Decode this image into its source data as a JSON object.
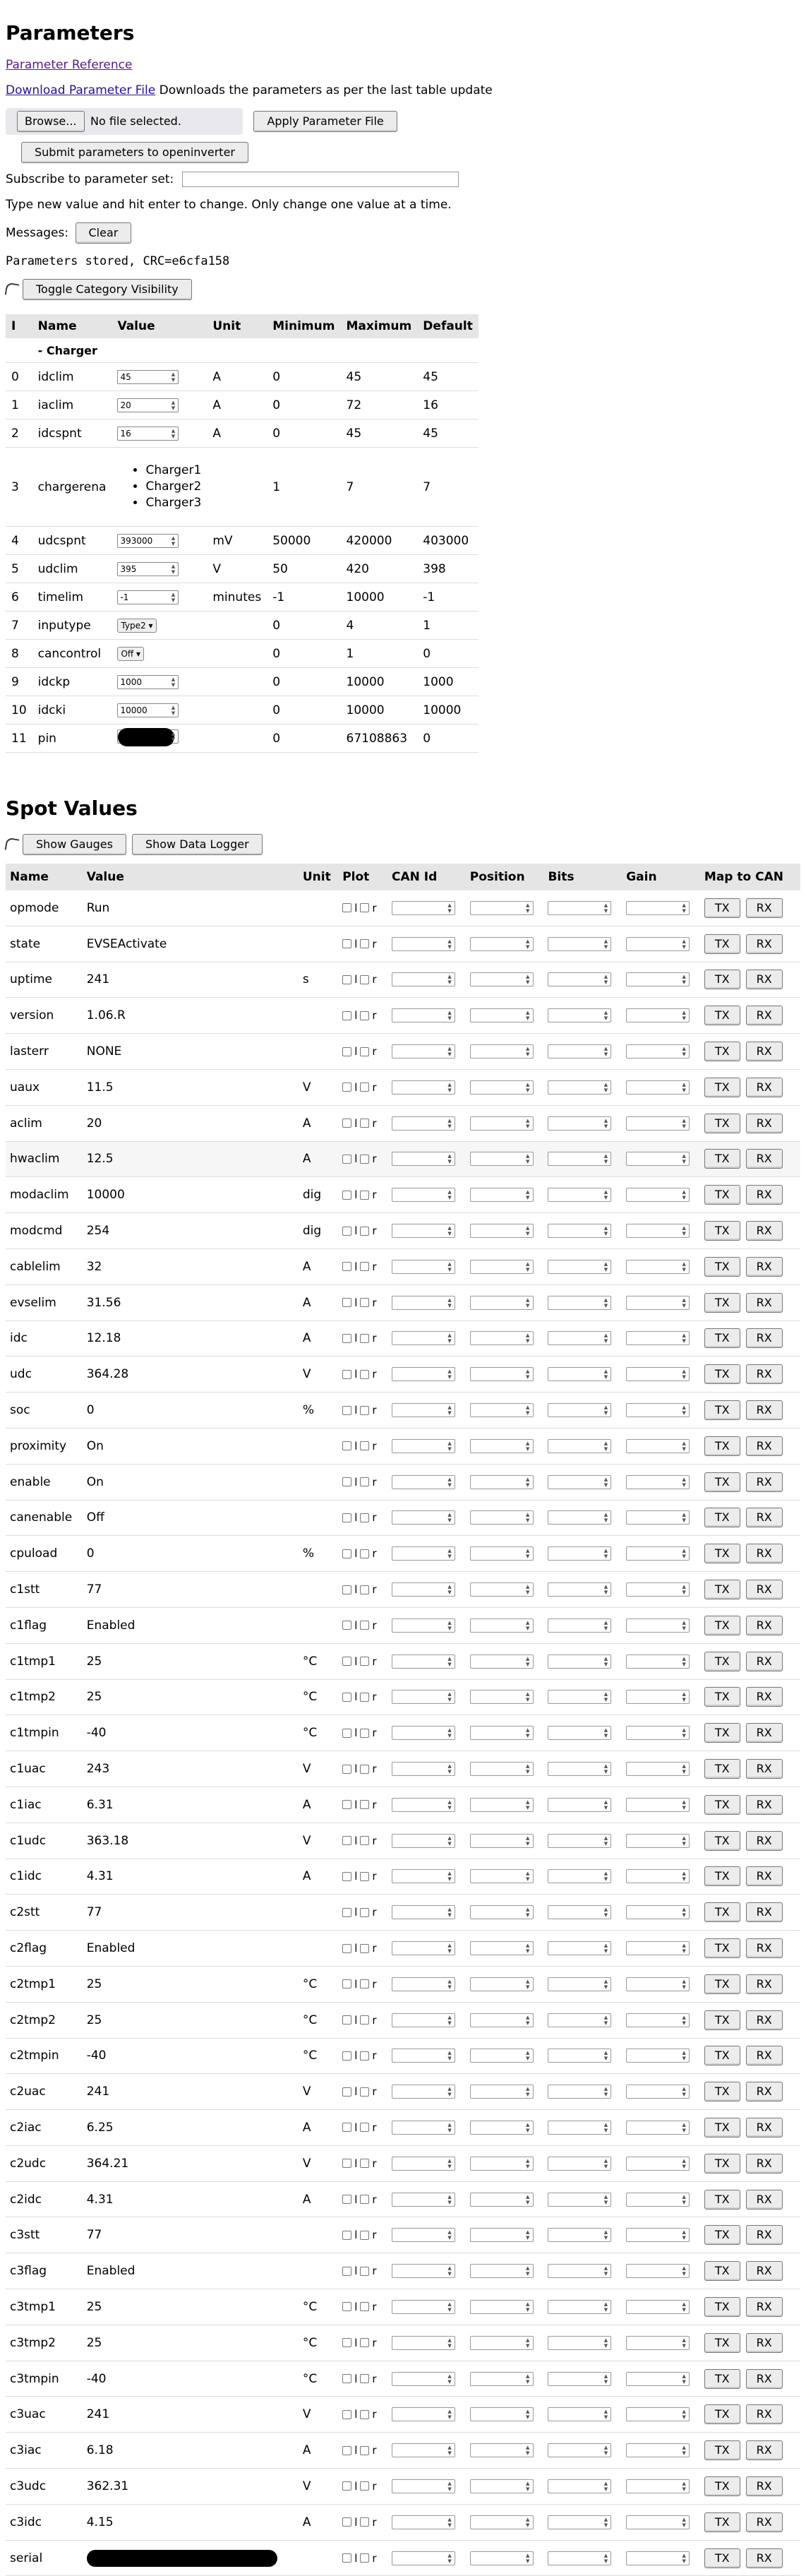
{
  "params_title": "Parameters",
  "links": {
    "reference": "Parameter Reference",
    "download": "Download Parameter File",
    "download_note": "Downloads the parameters as per the last table update"
  },
  "file": {
    "browse": "Browse...",
    "no_file": "No file selected.",
    "apply": "Apply Parameter File"
  },
  "submit_label": "Submit parameters to openinverter",
  "subscribe_label": "Subscribe to parameter set:",
  "instructions": "Type new value and hit enter to change. Only change one value at a time.",
  "messages_label": "Messages:",
  "clear_label": "Clear",
  "stored_msg": "Parameters stored, CRC=e6cfa158",
  "toggle_category": "Toggle Category Visibility",
  "param_headers": [
    "I",
    "Name",
    "Value",
    "Unit",
    "Minimum",
    "Maximum",
    "Default"
  ],
  "category": "- Charger",
  "params": [
    {
      "i": "0",
      "name": "idclim",
      "value": "45",
      "unit": "A",
      "min": "0",
      "max": "45",
      "def": "45"
    },
    {
      "i": "1",
      "name": "iaclim",
      "value": "20",
      "unit": "A",
      "min": "0",
      "max": "72",
      "def": "16"
    },
    {
      "i": "2",
      "name": "idcspnt",
      "value": "16",
      "unit": "A",
      "min": "0",
      "max": "45",
      "def": "45"
    },
    {
      "i": "3",
      "name": "chargerena",
      "options": [
        "Charger1",
        "Charger2",
        "Charger3"
      ],
      "unit": "",
      "min": "1",
      "max": "7",
      "def": "7"
    },
    {
      "i": "4",
      "name": "udcspnt",
      "value": "393000",
      "unit": "mV",
      "min": "50000",
      "max": "420000",
      "def": "403000"
    },
    {
      "i": "5",
      "name": "udclim",
      "value": "395",
      "unit": "V",
      "min": "50",
      "max": "420",
      "def": "398"
    },
    {
      "i": "6",
      "name": "timelim",
      "value": "-1",
      "unit": "minutes",
      "min": "-1",
      "max": "10000",
      "def": "-1"
    },
    {
      "i": "7",
      "name": "inputype",
      "select": "Type2",
      "unit": "",
      "min": "0",
      "max": "4",
      "def": "1"
    },
    {
      "i": "8",
      "name": "cancontrol",
      "select": "Off",
      "unit": "",
      "min": "0",
      "max": "1",
      "def": "0"
    },
    {
      "i": "9",
      "name": "idckp",
      "value": "1000",
      "unit": "",
      "min": "0",
      "max": "10000",
      "def": "1000"
    },
    {
      "i": "10",
      "name": "idcki",
      "value": "10000",
      "unit": "",
      "min": "0",
      "max": "10000",
      "def": "10000"
    },
    {
      "i": "11",
      "name": "pin",
      "redacted": true,
      "unit": "",
      "min": "0",
      "max": "67108863",
      "def": "0"
    }
  ],
  "spot_title": "Spot Values",
  "show_gauges": "Show Gauges",
  "show_logger": "Show Data Logger",
  "spot_headers": [
    "Name",
    "Value",
    "Unit",
    "Plot",
    "CAN Id",
    "Position",
    "Bits",
    "Gain",
    "Map to CAN"
  ],
  "plot_labels": {
    "l": "l",
    "r": "r"
  },
  "tx_label": "TX",
  "rx_label": "RX",
  "spots": [
    {
      "name": "opmode",
      "value": "Run",
      "unit": ""
    },
    {
      "name": "state",
      "value": "EVSEActivate",
      "unit": ""
    },
    {
      "name": "uptime",
      "value": "241",
      "unit": "s"
    },
    {
      "name": "version",
      "value": "1.06.R",
      "unit": ""
    },
    {
      "name": "lasterr",
      "value": "NONE",
      "unit": ""
    },
    {
      "name": "uaux",
      "value": "11.5",
      "unit": "V"
    },
    {
      "name": "aclim",
      "value": "20",
      "unit": "A"
    },
    {
      "name": "hwaclim",
      "value": "12.5",
      "unit": "A"
    },
    {
      "name": "modaclim",
      "value": "10000",
      "unit": "dig"
    },
    {
      "name": "modcmd",
      "value": "254",
      "unit": "dig"
    },
    {
      "name": "cablelim",
      "value": "32",
      "unit": "A"
    },
    {
      "name": "evselim",
      "value": "31.56",
      "unit": "A"
    },
    {
      "name": "idc",
      "value": "12.18",
      "unit": "A"
    },
    {
      "name": "udc",
      "value": "364.28",
      "unit": "V"
    },
    {
      "name": "soc",
      "value": "0",
      "unit": "%"
    },
    {
      "name": "proximity",
      "value": "On",
      "unit": ""
    },
    {
      "name": "enable",
      "value": "On",
      "unit": ""
    },
    {
      "name": "canenable",
      "value": "Off",
      "unit": ""
    },
    {
      "name": "cpuload",
      "value": "0",
      "unit": "%"
    },
    {
      "name": "c1stt",
      "value": "77",
      "unit": ""
    },
    {
      "name": "c1flag",
      "value": "Enabled",
      "unit": ""
    },
    {
      "name": "c1tmp1",
      "value": "25",
      "unit": "°C"
    },
    {
      "name": "c1tmp2",
      "value": "25",
      "unit": "°C"
    },
    {
      "name": "c1tmpin",
      "value": "-40",
      "unit": "°C"
    },
    {
      "name": "c1uac",
      "value": "243",
      "unit": "V"
    },
    {
      "name": "c1iac",
      "value": "6.31",
      "unit": "A"
    },
    {
      "name": "c1udc",
      "value": "363.18",
      "unit": "V"
    },
    {
      "name": "c1idc",
      "value": "4.31",
      "unit": "A"
    },
    {
      "name": "c2stt",
      "value": "77",
      "unit": ""
    },
    {
      "name": "c2flag",
      "value": "Enabled",
      "unit": ""
    },
    {
      "name": "c2tmp1",
      "value": "25",
      "unit": "°C"
    },
    {
      "name": "c2tmp2",
      "value": "25",
      "unit": "°C"
    },
    {
      "name": "c2tmpin",
      "value": "-40",
      "unit": "°C"
    },
    {
      "name": "c2uac",
      "value": "241",
      "unit": "V"
    },
    {
      "name": "c2iac",
      "value": "6.25",
      "unit": "A"
    },
    {
      "name": "c2udc",
      "value": "364.21",
      "unit": "V"
    },
    {
      "name": "c2idc",
      "value": "4.31",
      "unit": "A"
    },
    {
      "name": "c3stt",
      "value": "77",
      "unit": ""
    },
    {
      "name": "c3flag",
      "value": "Enabled",
      "unit": ""
    },
    {
      "name": "c3tmp1",
      "value": "25",
      "unit": "°C"
    },
    {
      "name": "c3tmp2",
      "value": "25",
      "unit": "°C"
    },
    {
      "name": "c3tmpin",
      "value": "-40",
      "unit": "°C"
    },
    {
      "name": "c3uac",
      "value": "241",
      "unit": "V"
    },
    {
      "name": "c3iac",
      "value": "6.18",
      "unit": "A"
    },
    {
      "name": "c3udc",
      "value": "362.31",
      "unit": "V"
    },
    {
      "name": "c3idc",
      "value": "4.15",
      "unit": "A"
    },
    {
      "name": "serial",
      "redacted": true,
      "unit": ""
    }
  ]
}
